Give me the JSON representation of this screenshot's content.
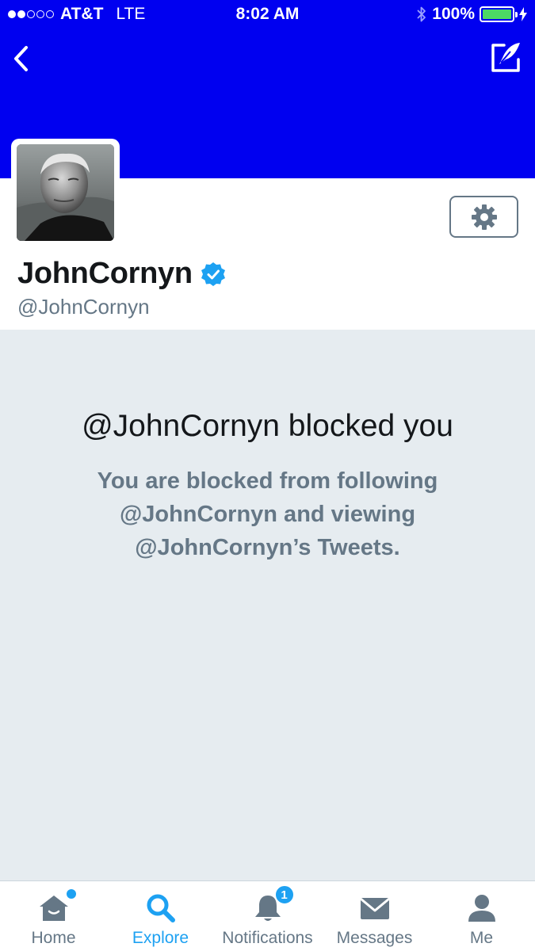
{
  "status_bar": {
    "carrier": "AT&T",
    "network": "LTE",
    "time": "8:02 AM",
    "battery": "100%",
    "signal_bars_filled": 2,
    "signal_bars_total": 5,
    "battery_level": 1.0,
    "icons": [
      "bluetooth-icon",
      "battery-icon",
      "charging-bolt-icon"
    ]
  },
  "header": {
    "background_color": "#0000f0",
    "back_icon": "chevron-left-icon",
    "compose_icon": "compose-tweet-icon"
  },
  "profile": {
    "name": "JohnCornyn",
    "handle": "@JohnCornyn",
    "verified": true,
    "verified_color": "#1da1f2",
    "settings_icon": "gear-icon"
  },
  "blocked": {
    "title": "@JohnCornyn blocked you",
    "message": "You are blocked from following @JohnCornyn and viewing @JohnCornyn’s Tweets."
  },
  "tab_bar": {
    "active_color": "#1da1f2",
    "inactive_color": "#657786",
    "tabs": [
      {
        "label": "Home",
        "icon": "home-icon",
        "active": false,
        "dot": true
      },
      {
        "label": "Explore",
        "icon": "search-icon",
        "active": true
      },
      {
        "label": "Notifications",
        "icon": "bell-icon",
        "active": false,
        "badge": "1"
      },
      {
        "label": "Messages",
        "icon": "envelope-icon",
        "active": false
      },
      {
        "label": "Me",
        "icon": "person-icon",
        "active": false
      }
    ]
  }
}
